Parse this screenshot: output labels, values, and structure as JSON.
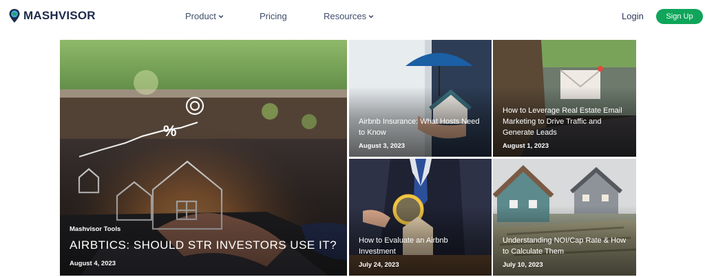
{
  "brand": {
    "name": "MASHVISOR"
  },
  "nav": {
    "items": [
      {
        "label": "Product"
      },
      {
        "label": "Pricing"
      },
      {
        "label": "Resources"
      }
    ],
    "login_label": "Login",
    "signup_label": "Sign Up"
  },
  "colors": {
    "brand_navy": "#1d2a4a",
    "nav_text": "#3f4c6b",
    "signup_green": "#0fa55a"
  },
  "featured": {
    "category": "Mashvisor Tools",
    "title": "AIRBTICS: SHOULD STR INVESTORS USE IT?",
    "date": "August 4, 2023"
  },
  "articles": [
    {
      "title": "Airbnb Insurance: What Hosts Need to Know",
      "date": "August 3, 2023"
    },
    {
      "title": "How to Leverage Real Estate Email Marketing to Drive Traffic and Generate Leads",
      "date": "August 1, 2023"
    },
    {
      "title": "How to Evaluate an Airbnb Investment",
      "date": "July 24, 2023"
    },
    {
      "title": "Understanding NOI/Cap Rate & How to Calculate Them",
      "date": "July 10, 2023"
    }
  ]
}
